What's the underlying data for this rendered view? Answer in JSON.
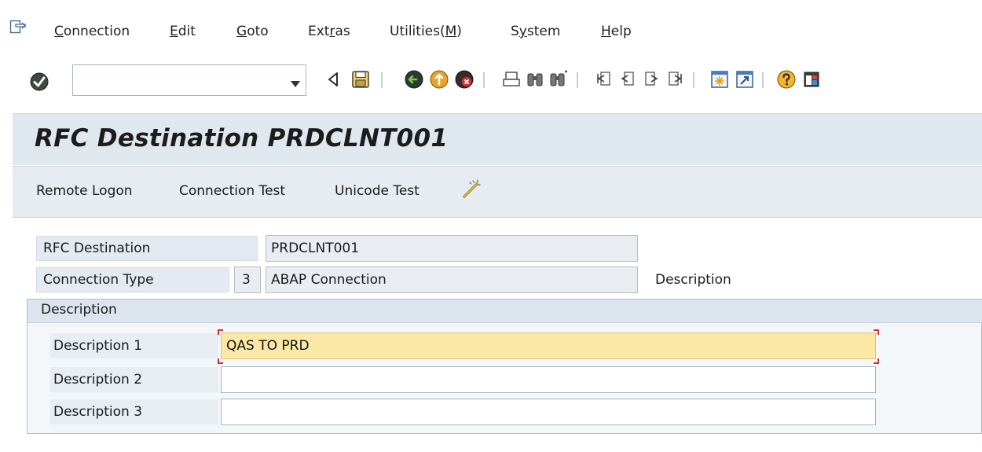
{
  "menu": {
    "items": [
      {
        "id": "connection",
        "pre": "",
        "u": "C",
        "post": "onnection"
      },
      {
        "id": "edit",
        "pre": "",
        "u": "E",
        "post": "dit"
      },
      {
        "id": "goto",
        "pre": "",
        "u": "G",
        "post": "oto"
      },
      {
        "id": "extras",
        "pre": "Ext",
        "u": "r",
        "post": "as"
      },
      {
        "id": "utilities",
        "pre": "Utilities(",
        "u": "M",
        "post": ")"
      },
      {
        "id": "system",
        "pre": "S",
        "u": "y",
        "post": "stem"
      },
      {
        "id": "help",
        "pre": "",
        "u": "H",
        "post": "elp"
      }
    ]
  },
  "toolbar": {
    "command_field_value": "",
    "icons": [
      "enter-icon",
      "command-dropdown-icon",
      "back-arrow-icon",
      "save-icon",
      "back-icon",
      "exit-icon",
      "cancel-icon",
      "print-icon",
      "find-icon",
      "find-next-icon",
      "first-page-icon",
      "previous-page-icon",
      "next-page-icon",
      "last-page-icon",
      "new-session-icon",
      "create-shortcut-icon",
      "help-icon",
      "customize-layout-icon"
    ]
  },
  "title": {
    "text": "RFC Destination PRDCLNT001"
  },
  "app_toolbar": {
    "remote_logon": "Remote Logon",
    "connection_test": "Connection Test",
    "unicode_test": "Unicode Test",
    "extra_icon": "wand-icon"
  },
  "form": {
    "rfc_destination_label": "RFC Destination",
    "rfc_destination_value": "PRDCLNT001",
    "connection_type_label": "Connection Type",
    "connection_type_code": "3",
    "connection_type_value": "ABAP Connection",
    "description_label": "Description"
  },
  "description_group": {
    "title": "Description",
    "rows": [
      {
        "label": "Description 1",
        "value": "QAS TO PRD"
      },
      {
        "label": "Description 2",
        "value": ""
      },
      {
        "label": "Description 3",
        "value": ""
      }
    ]
  },
  "colors": {
    "title_bg": "#dfe7ef",
    "app_toolbar_bg": "#e6ecf2",
    "focused_input_bg": "#fbe8a6",
    "selection": "#3d6db5"
  }
}
